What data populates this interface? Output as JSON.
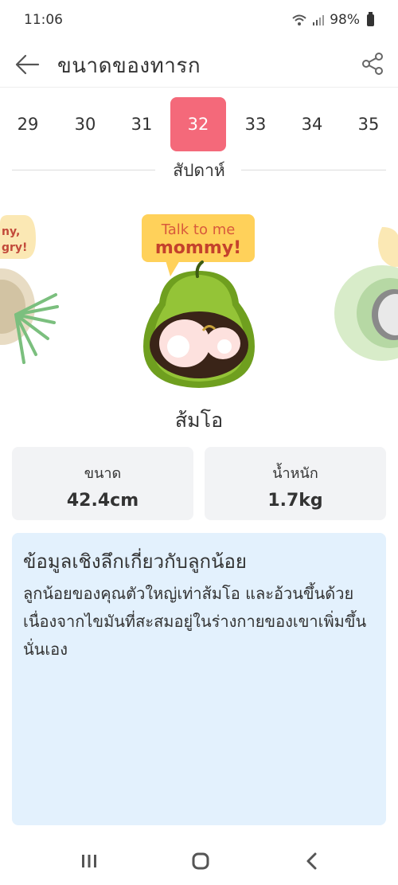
{
  "status": {
    "time": "11:06",
    "battery": "98%"
  },
  "header": {
    "title": "ขนาดของทารก"
  },
  "weeks": {
    "items": [
      "29",
      "30",
      "31",
      "32",
      "33",
      "34",
      "35"
    ],
    "selected": "32",
    "label": "สัปดาห์"
  },
  "illustration": {
    "speech_line1": "Talk to me",
    "speech_line2": "mommy!",
    "left_bubble_line1": "ny,",
    "left_bubble_line2": "gry!"
  },
  "fruit": {
    "name": "ส้มโอ"
  },
  "stats": {
    "size_label": "ขนาด",
    "size_value": "42.4cm",
    "weight_label": "น้ำหนัก",
    "weight_value": "1.7kg"
  },
  "insight": {
    "title": "ข้อมูลเชิงลึกเกี่ยวกับลูกน้อย",
    "body": "ลูกน้อยของคุณตัวใหญ่เท่าส้มโอ และอ้วนขึ้นด้วย เนื่องจากไขมันที่สะสมอยู่ในร่างกายของเขาเพิ่มขึ้นนั่นเอง"
  },
  "colors": {
    "accent": "#f4697a",
    "insight_bg": "#e3f1fd",
    "card_bg": "#f2f3f5"
  }
}
